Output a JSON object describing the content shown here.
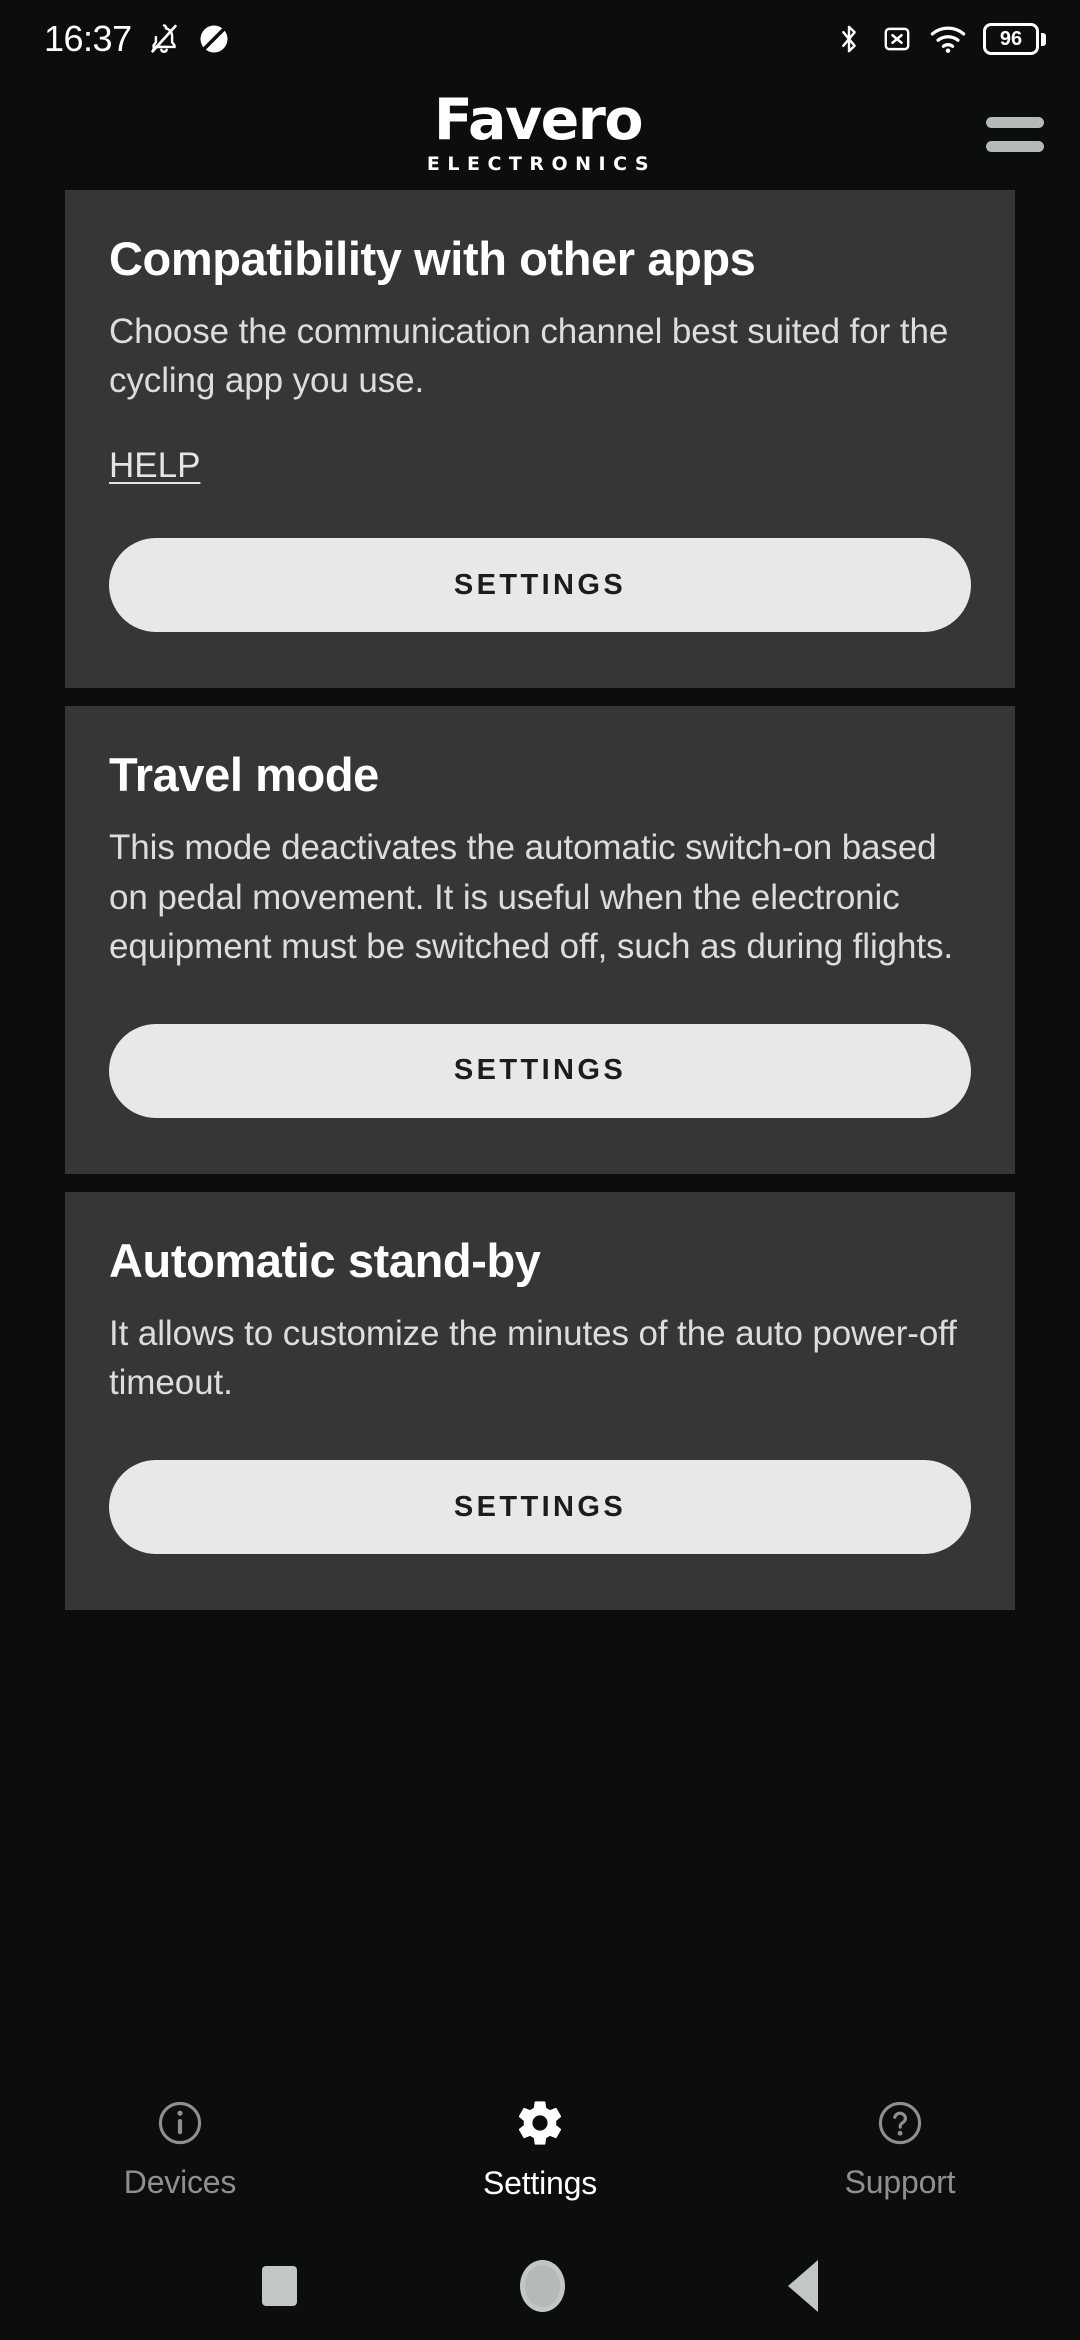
{
  "status_bar": {
    "time": "16:37",
    "left_icons": [
      "notifications-muted-icon",
      "dnd-icon"
    ],
    "right_icons": [
      "bluetooth-icon",
      "no-sim-icon",
      "wifi-icon",
      "battery-icon"
    ],
    "battery_level": "96"
  },
  "header": {
    "brand_name": "Favero",
    "brand_subtitle": "ELECTRONICS",
    "menu_icon": "hamburger-menu-icon"
  },
  "cards": [
    {
      "title": "Compatibility with other apps",
      "body": "Choose the communication channel best suited for the cycling app you use.",
      "link_label": "HELP",
      "button_label": "SETTINGS"
    },
    {
      "title": "Travel mode",
      "body": "This mode deactivates the automatic switch-on based on pedal movement. It is useful when the electronic equipment must be switched off, such as during flights.",
      "link_label": null,
      "button_label": "SETTINGS"
    },
    {
      "title": "Automatic stand-by",
      "body": "It allows to customize the minutes of the auto power-off timeout.",
      "link_label": null,
      "button_label": "SETTINGS"
    }
  ],
  "bottom_nav": [
    {
      "label": "Devices",
      "icon": "info-circle-icon",
      "active": false
    },
    {
      "label": "Settings",
      "icon": "gear-icon",
      "active": true
    },
    {
      "label": "Support",
      "icon": "question-circle-icon",
      "active": false
    }
  ],
  "system_nav": {
    "recents": "square-recents-icon",
    "home": "circle-home-icon",
    "back": "triangle-back-icon"
  },
  "colors": {
    "page_background": "#0c0d0d",
    "card_background": "#343637",
    "button_background": "#e7e9e8",
    "button_text": "#1b1d1d",
    "title_text": "#ffffff",
    "body_text": "#dcdedd",
    "nav_inactive": "#8d9090",
    "nav_active": "#ffffff",
    "icon_gray": "#c3c6c6"
  }
}
